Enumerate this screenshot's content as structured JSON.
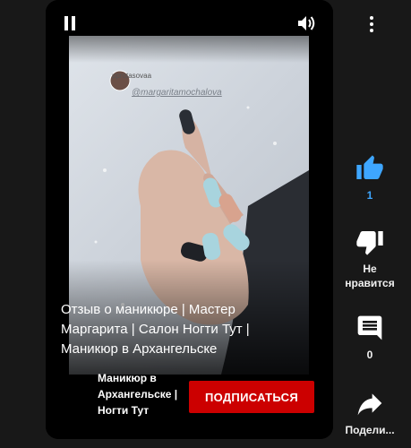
{
  "video": {
    "title": "Отзыв о маникюре | Мастер Маргарита | Салон Ногти Тут | Маникюр в Архангельске",
    "channel": "Маникюр в Архангельске | Ногти Тут",
    "subscribe_label": "ПОДПИСАТЬСЯ",
    "overlay_user": "pprotasovaa",
    "overlay_handle": "@margaritamochalova"
  },
  "actions": {
    "like_count": "1",
    "dislike_label": "Не нравится",
    "comment_count": "0",
    "share_label": "Подели..."
  },
  "colors": {
    "accent": "#3ea6ff",
    "subscribe": "#cc0000",
    "background": "#181818"
  },
  "icons": [
    "pause-icon",
    "volume-icon",
    "more-vert-icon",
    "thumb-up-icon",
    "thumb-down-icon",
    "comment-icon",
    "share-icon"
  ]
}
